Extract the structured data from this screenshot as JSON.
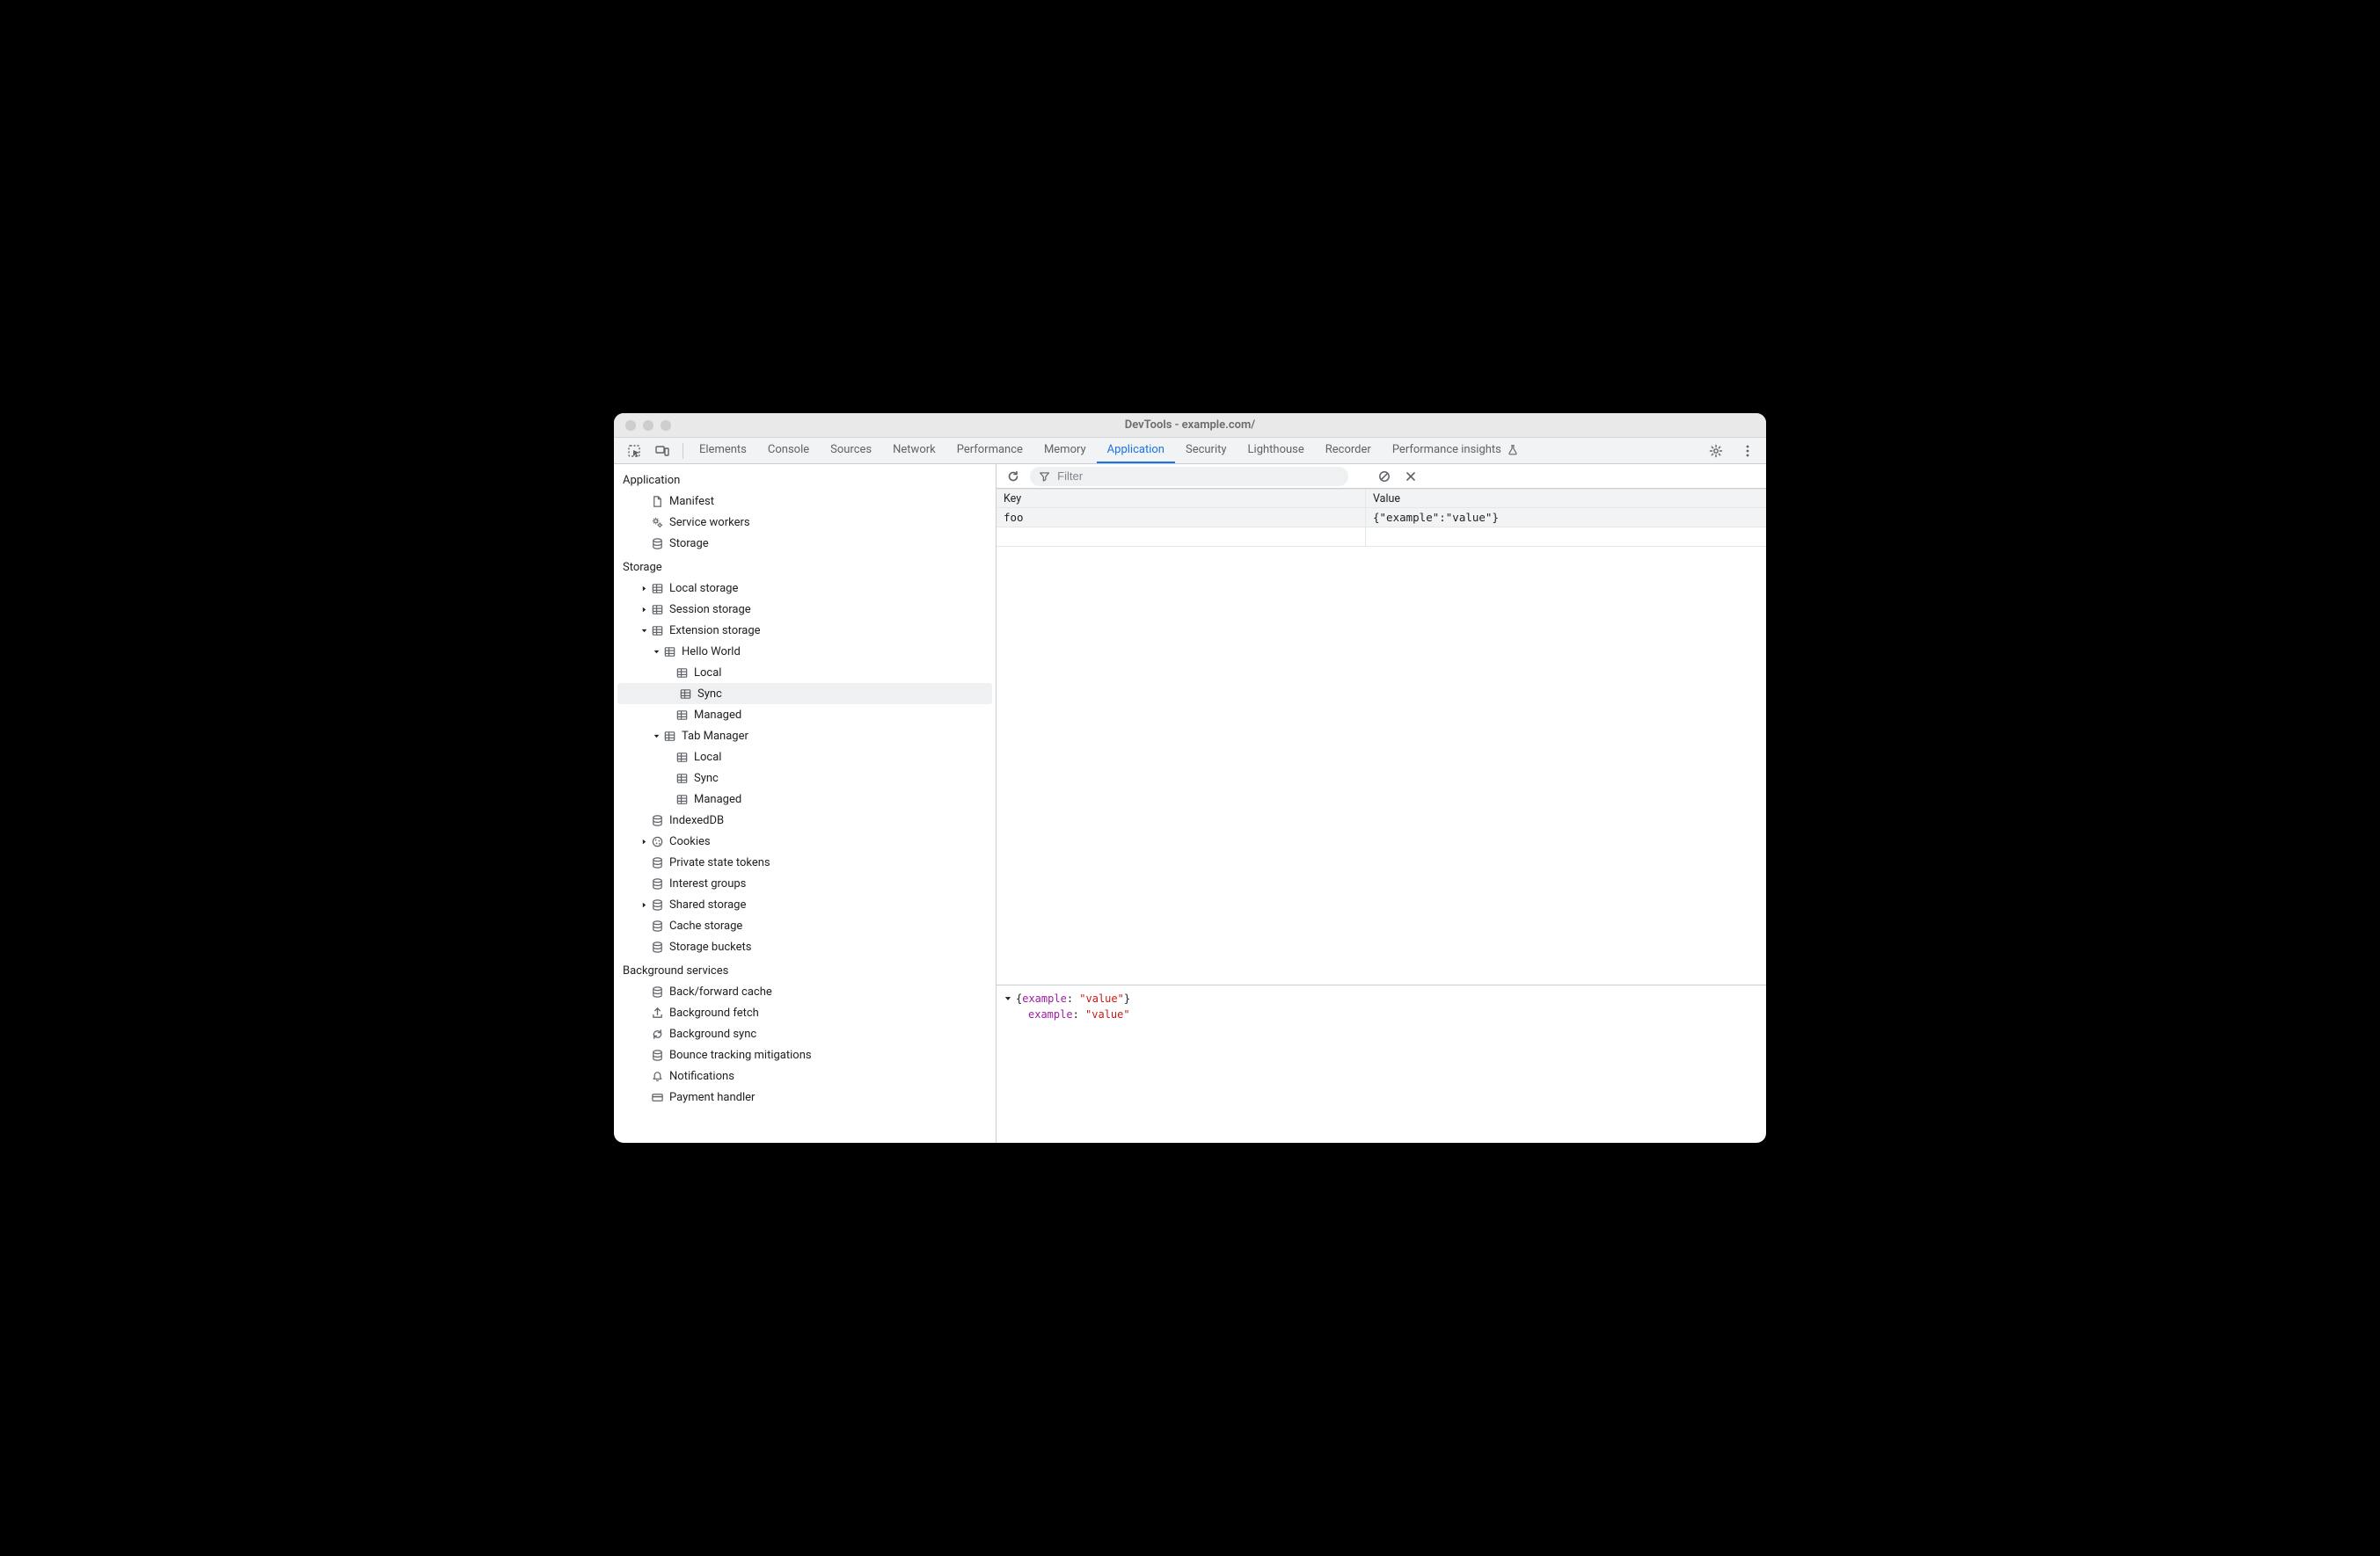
{
  "window": {
    "title": "DevTools - example.com/"
  },
  "tabs": {
    "items": [
      {
        "label": "Elements",
        "active": false
      },
      {
        "label": "Console",
        "active": false
      },
      {
        "label": "Sources",
        "active": false
      },
      {
        "label": "Network",
        "active": false
      },
      {
        "label": "Performance",
        "active": false
      },
      {
        "label": "Memory",
        "active": false
      },
      {
        "label": "Application",
        "active": true
      },
      {
        "label": "Security",
        "active": false
      },
      {
        "label": "Lighthouse",
        "active": false
      },
      {
        "label": "Recorder",
        "active": false
      },
      {
        "label": "Performance insights",
        "active": false,
        "flask": true
      }
    ]
  },
  "sidebar": {
    "groups": [
      {
        "title": "Application",
        "items": [
          {
            "label": "Manifest",
            "icon": "file-icon"
          },
          {
            "label": "Service workers",
            "icon": "gears-icon"
          },
          {
            "label": "Storage",
            "icon": "database-icon"
          }
        ]
      },
      {
        "title": "Storage",
        "items": [
          {
            "label": "Local storage",
            "icon": "table-icon",
            "expandable": true,
            "expanded": false
          },
          {
            "label": "Session storage",
            "icon": "table-icon",
            "expandable": true,
            "expanded": false
          },
          {
            "label": "Extension storage",
            "icon": "table-icon",
            "expandable": true,
            "expanded": true,
            "children": [
              {
                "label": "Hello World",
                "icon": "table-icon",
                "expandable": true,
                "expanded": true,
                "children": [
                  {
                    "label": "Local",
                    "icon": "table-icon"
                  },
                  {
                    "label": "Sync",
                    "icon": "table-icon",
                    "selected": true
                  },
                  {
                    "label": "Managed",
                    "icon": "table-icon"
                  }
                ]
              },
              {
                "label": "Tab Manager",
                "icon": "table-icon",
                "expandable": true,
                "expanded": true,
                "children": [
                  {
                    "label": "Local",
                    "icon": "table-icon"
                  },
                  {
                    "label": "Sync",
                    "icon": "table-icon"
                  },
                  {
                    "label": "Managed",
                    "icon": "table-icon"
                  }
                ]
              }
            ]
          },
          {
            "label": "IndexedDB",
            "icon": "database-icon"
          },
          {
            "label": "Cookies",
            "icon": "cookie-icon",
            "expandable": true,
            "expanded": false
          },
          {
            "label": "Private state tokens",
            "icon": "database-icon"
          },
          {
            "label": "Interest groups",
            "icon": "database-icon"
          },
          {
            "label": "Shared storage",
            "icon": "database-icon",
            "expandable": true,
            "expanded": false
          },
          {
            "label": "Cache storage",
            "icon": "database-icon"
          },
          {
            "label": "Storage buckets",
            "icon": "database-icon"
          }
        ]
      },
      {
        "title": "Background services",
        "items": [
          {
            "label": "Back/forward cache",
            "icon": "database-icon"
          },
          {
            "label": "Background fetch",
            "icon": "bgfetch-icon"
          },
          {
            "label": "Background sync",
            "icon": "sync-icon"
          },
          {
            "label": "Bounce tracking mitigations",
            "icon": "database-icon"
          },
          {
            "label": "Notifications",
            "icon": "bell-icon"
          },
          {
            "label": "Payment handler",
            "icon": "card-icon"
          }
        ]
      }
    ]
  },
  "toolbar": {
    "filter_placeholder": "Filter"
  },
  "table": {
    "headers": {
      "key": "Key",
      "value": "Value"
    },
    "rows": [
      {
        "key": "foo",
        "value": "{\"example\":\"value\"}"
      }
    ]
  },
  "detail": {
    "summary_prefix": "{",
    "summary_key": "example",
    "summary_sep": ": ",
    "summary_val": "\"value\"",
    "summary_suffix": "}",
    "prop_key": "example",
    "prop_sep": ": ",
    "prop_val": "\"value\""
  }
}
